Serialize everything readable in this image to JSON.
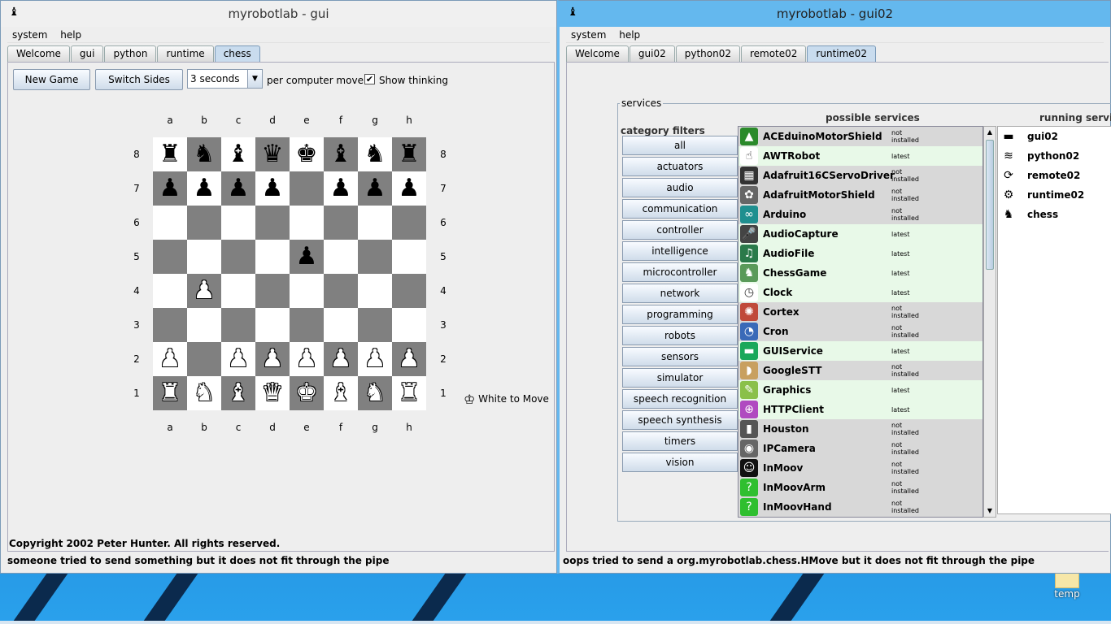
{
  "win1": {
    "title": "myrobotlab - gui",
    "menu": [
      "system",
      "help"
    ],
    "tabs": [
      "Welcome",
      "gui",
      "python",
      "runtime",
      "chess"
    ],
    "controls": {
      "new_game": "New Game",
      "switch_sides": "Switch Sides",
      "time_value": "3 seconds",
      "per_move": "per computer move",
      "show_thinking": "Show thinking",
      "show_thinking_checked": true
    },
    "files": [
      "a",
      "b",
      "c",
      "d",
      "e",
      "f",
      "g",
      "h"
    ],
    "ranks": [
      "8",
      "7",
      "6",
      "5",
      "4",
      "3",
      "2",
      "1"
    ],
    "board": [
      [
        "r",
        "n",
        "b",
        "q",
        "k",
        "b",
        "n",
        "r"
      ],
      [
        "p",
        "p",
        "p",
        "p",
        "",
        "p",
        "p",
        "p"
      ],
      [
        "",
        "",
        "",
        "",
        "",
        "",
        "",
        ""
      ],
      [
        "",
        "",
        "",
        "",
        "p",
        "",
        "",
        ""
      ],
      [
        "",
        "P",
        "",
        "",
        "",
        "",
        "",
        ""
      ],
      [
        "",
        "",
        "",
        "",
        "",
        "",
        "",
        ""
      ],
      [
        "P",
        "",
        "P",
        "P",
        "P",
        "P",
        "P",
        "P"
      ],
      [
        "R",
        "N",
        "B",
        "Q",
        "K",
        "B",
        "N",
        "R"
      ]
    ],
    "turn": "White to Move",
    "copyright": "Copyright 2002 Peter Hunter. All rights reserved.",
    "status": "someone tried to send something but it does not fit through the pipe"
  },
  "win2": {
    "title": "myrobotlab - gui02",
    "menu": [
      "system",
      "help"
    ],
    "tabs": [
      "Welcome",
      "gui02",
      "python02",
      "remote02",
      "runtime02"
    ],
    "services_label": "services",
    "category_label": "category filters",
    "possible_label": "possible services",
    "running_label": "running services",
    "categories": [
      "all",
      "actuators",
      "audio",
      "communication",
      "controller",
      "intelligence",
      "microcontroller",
      "network",
      "programming",
      "robots",
      "sensors",
      "simulator",
      "speech recognition",
      "speech synthesis",
      "timers",
      "vision"
    ],
    "possible": [
      {
        "name": "ACEduinoMotorShield",
        "status": "not installed",
        "installed": false,
        "icon": "ace-icon",
        "color": "#2a8a2a"
      },
      {
        "name": "AWTRobot",
        "status": "latest",
        "installed": true,
        "icon": "hand-icon",
        "color": "#ffffff"
      },
      {
        "name": "Adafruit16CServoDriver",
        "status": "not installed",
        "installed": false,
        "icon": "board-icon",
        "color": "#333333"
      },
      {
        "name": "AdafruitMotorShield",
        "status": "not installed",
        "installed": false,
        "icon": "flower-icon",
        "color": "#666666"
      },
      {
        "name": "Arduino",
        "status": "not installed",
        "installed": false,
        "icon": "arduino-icon",
        "color": "#1f8f8f"
      },
      {
        "name": "AudioCapture",
        "status": "latest",
        "installed": true,
        "icon": "mic-icon",
        "color": "#444444"
      },
      {
        "name": "AudioFile",
        "status": "latest",
        "installed": true,
        "icon": "notes-icon",
        "color": "#2a7a4a"
      },
      {
        "name": "ChessGame",
        "status": "latest",
        "installed": true,
        "icon": "chess-icon",
        "color": "#5a9a5a"
      },
      {
        "name": "Clock",
        "status": "latest",
        "installed": true,
        "icon": "clock-icon",
        "color": "#ffffff"
      },
      {
        "name": "Cortex",
        "status": "not installed",
        "installed": false,
        "icon": "brain-icon",
        "color": "#c04a3a"
      },
      {
        "name": "Cron",
        "status": "not installed",
        "installed": false,
        "icon": "cron-icon",
        "color": "#3a6ab8"
      },
      {
        "name": "GUIService",
        "status": "latest",
        "installed": true,
        "icon": "gui-icon",
        "color": "#1aa85a"
      },
      {
        "name": "GoogleSTT",
        "status": "not installed",
        "installed": false,
        "icon": "ear-icon",
        "color": "#c8a060"
      },
      {
        "name": "Graphics",
        "status": "latest",
        "installed": true,
        "icon": "graphics-icon",
        "color": "#8ac04a"
      },
      {
        "name": "HTTPClient",
        "status": "latest",
        "installed": true,
        "icon": "http-icon",
        "color": "#b04ac0"
      },
      {
        "name": "Houston",
        "status": "not installed",
        "installed": false,
        "icon": "robot-icon",
        "color": "#555555"
      },
      {
        "name": "IPCamera",
        "status": "not installed",
        "installed": false,
        "icon": "camera-icon",
        "color": "#666666"
      },
      {
        "name": "InMoov",
        "status": "not installed",
        "installed": false,
        "icon": "face-icon",
        "color": "#111111"
      },
      {
        "name": "InMoovArm",
        "status": "not installed",
        "installed": false,
        "icon": "question-icon",
        "color": "#2fbf2f"
      },
      {
        "name": "InMoovHand",
        "status": "not installed",
        "installed": false,
        "icon": "question-icon",
        "color": "#2fbf2f"
      }
    ],
    "running": [
      {
        "name": "gui02",
        "icon": "gui-icon"
      },
      {
        "name": "python02",
        "icon": "python-icon"
      },
      {
        "name": "remote02",
        "icon": "remote-icon"
      },
      {
        "name": "runtime02",
        "icon": "runtime-icon"
      },
      {
        "name": "chess",
        "icon": "chess-icon"
      }
    ],
    "status": "oops tried to send a org.myrobotlab.chess.HMove but it does not fit through the pipe"
  },
  "desktop": {
    "icon_label": "temp"
  }
}
